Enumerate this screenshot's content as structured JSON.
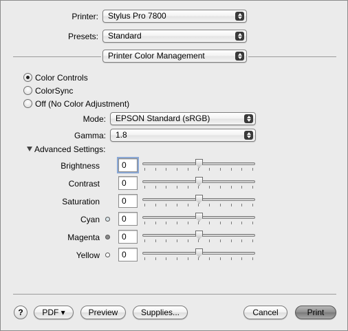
{
  "printer": {
    "label": "Printer:",
    "value": "Stylus Pro 7800"
  },
  "presets": {
    "label": "Presets:",
    "value": "Standard"
  },
  "panel_menu": {
    "value": "Printer Color Management"
  },
  "color_options": [
    {
      "label": "Color Controls",
      "selected": true
    },
    {
      "label": "ColorSync",
      "selected": false
    },
    {
      "label": "Off (No Color Adjustment)",
      "selected": false
    }
  ],
  "mode": {
    "label": "Mode:",
    "value": "EPSON Standard (sRGB)"
  },
  "gamma": {
    "label": "Gamma:",
    "value": "1.8"
  },
  "advanced": {
    "label": "Advanced Settings:",
    "expanded": true
  },
  "adjustments": [
    {
      "label": "Brightness",
      "value": "0",
      "slider_fraction": 0.5,
      "swatch": null
    },
    {
      "label": "Contrast",
      "value": "0",
      "slider_fraction": 0.5,
      "swatch": null
    },
    {
      "label": "Saturation",
      "value": "0",
      "slider_fraction": 0.5,
      "swatch": null
    },
    {
      "label": "Cyan",
      "value": "0",
      "slider_fraction": 0.5,
      "swatch": "#d8e4e8"
    },
    {
      "label": "Magenta",
      "value": "0",
      "slider_fraction": 0.5,
      "swatch": "#8a8a8a"
    },
    {
      "label": "Yellow",
      "value": "0",
      "slider_fraction": 0.5,
      "swatch": "#ffffff"
    }
  ],
  "footer": {
    "help": "?",
    "pdf": "PDF ▾",
    "preview": "Preview",
    "supplies": "Supplies...",
    "cancel": "Cancel",
    "print": "Print"
  },
  "icons": {
    "popup_arrows": "up-down-arrows-icon",
    "disclosure": "disclosure-triangle-down-icon"
  }
}
